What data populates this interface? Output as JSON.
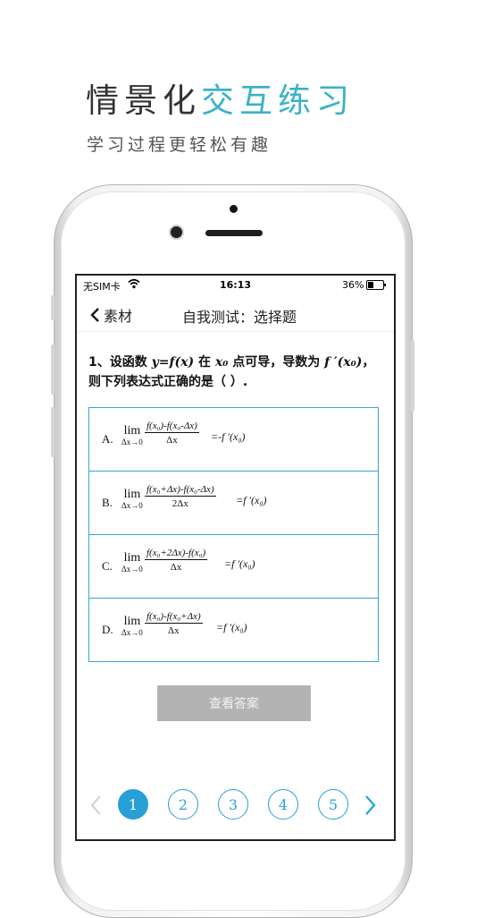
{
  "hero": {
    "title_dark": "情景化",
    "title_accent": "交互练习",
    "subtitle": "学习过程更轻松有趣"
  },
  "status_bar": {
    "carrier": "无SIM卡",
    "time": "16:13",
    "battery": "36%"
  },
  "nav": {
    "back_label": "素材",
    "title": "自我测试：选择题"
  },
  "question": {
    "prefix": "1、设函数",
    "func": "y=f(x)",
    "mid": "在",
    "point": "x₀",
    "mid2": "点可导，导数为",
    "deriv": "f ′(x₀)",
    "suffix": "，则下列表达式正确的是（ ）."
  },
  "options": [
    {
      "label": "A.",
      "lim_word": "lim",
      "lim_sub": "Δx→0",
      "numerator": "f(x₀)-f(x₀-Δx)",
      "denominator": "Δx",
      "rhs": "=-f ′(x₀)"
    },
    {
      "label": "B.",
      "lim_word": "lim",
      "lim_sub": "Δx→0",
      "numerator": "f(x₀+Δx)-f(x₀-Δx)",
      "denominator": "2Δx",
      "rhs": "=f ′(x₀)"
    },
    {
      "label": "C.",
      "lim_word": "lim",
      "lim_sub": "Δx→0",
      "numerator": "f(x₀+2Δx)-f(x₀)",
      "denominator": "Δx",
      "rhs": "=f ′(x₀)"
    },
    {
      "label": "D.",
      "lim_word": "lim",
      "lim_sub": "Δx→0",
      "numerator": "f(x₀)-f(x₀+Δx)",
      "denominator": "Δx",
      "rhs": "=f ′(x₀)"
    }
  ],
  "answer_button": "查看答案",
  "pager": {
    "pages": [
      "1",
      "2",
      "3",
      "4",
      "5"
    ],
    "current": "1"
  },
  "colors": {
    "accent": "#3bb2c6",
    "option_border": "#3ba4d3",
    "pager_blue": "#27a0d8",
    "button_gray": "#b3b3b3"
  }
}
